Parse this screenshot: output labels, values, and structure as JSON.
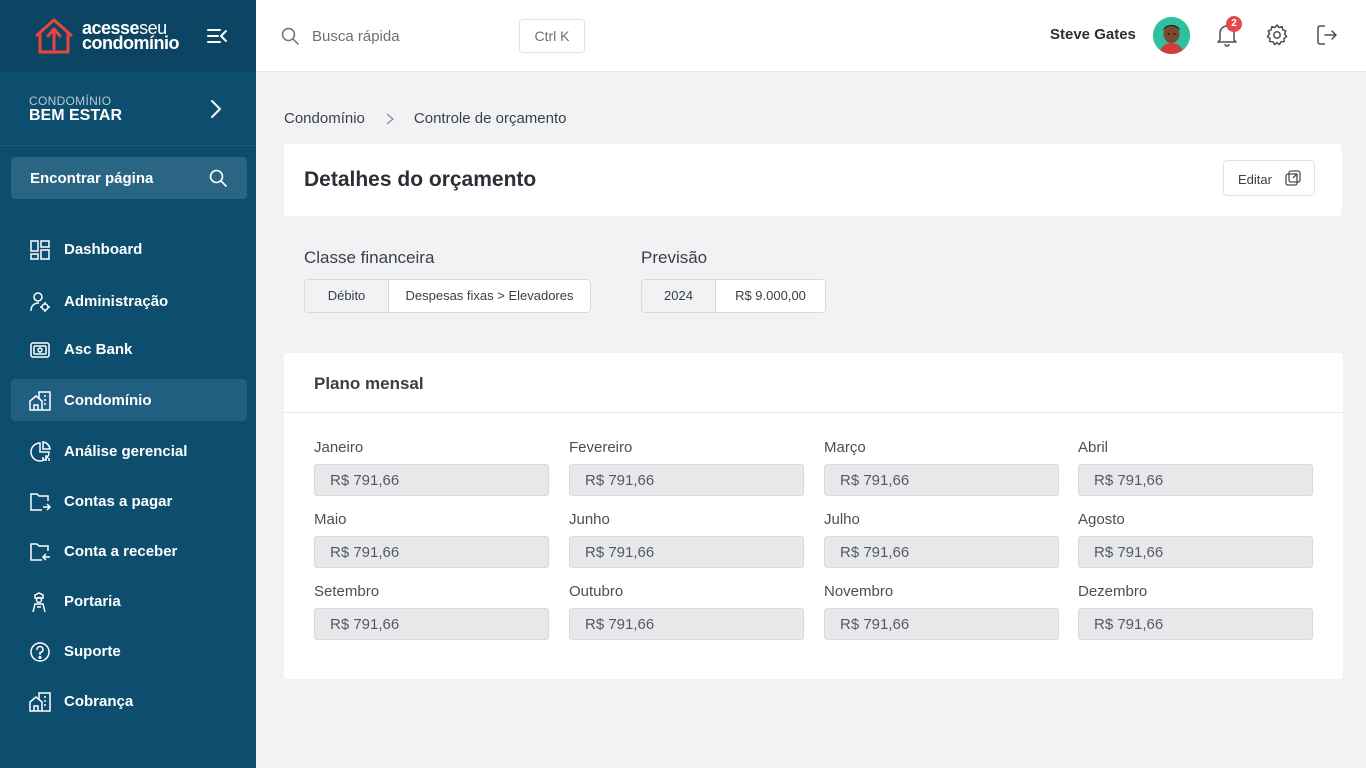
{
  "brand": {
    "line1_bold": "acesse",
    "line1_thin": "seu",
    "line2": "condomínio",
    "color": "#e8463d"
  },
  "sidebar": {
    "condo_caption": "CONDOMÍNIO",
    "condo_name": "BEM ESTAR",
    "find_label": "Encontrar página",
    "items": [
      {
        "label": "Dashboard",
        "icon": "dashboard-icon"
      },
      {
        "label": "Administração",
        "icon": "user-gear-icon"
      },
      {
        "label": "Asc Bank",
        "icon": "bank-icon"
      },
      {
        "label": "Condomínio",
        "icon": "building-icon",
        "active": true
      },
      {
        "label": "Análise gerencial",
        "icon": "analytics-icon"
      },
      {
        "label": "Contas a pagar",
        "icon": "folder-out-icon"
      },
      {
        "label": "Conta a receber",
        "icon": "folder-in-icon"
      },
      {
        "label": "Portaria",
        "icon": "doorman-icon"
      },
      {
        "label": "Suporte",
        "icon": "help-icon"
      },
      {
        "label": "Cobrança",
        "icon": "building-icon"
      }
    ]
  },
  "topbar": {
    "search_placeholder": "Busca rápida",
    "shortcut": "Ctrl K",
    "username": "Steve Gates",
    "notifications": "2"
  },
  "breadcrumb": {
    "root": "Condomínio",
    "current": "Controle de orçamento"
  },
  "header": {
    "title": "Detalhes do orçamento",
    "edit_label": "Editar"
  },
  "info": {
    "class_label": "Classe financeira",
    "class_type": "Débito",
    "class_path": "Despesas fixas > Elevadores",
    "forecast_label": "Previsão",
    "forecast_year": "2024",
    "forecast_value": "R$ 9.000,00"
  },
  "plan": {
    "title": "Plano mensal",
    "months": [
      {
        "label": "Janeiro",
        "value": "R$ 791,66"
      },
      {
        "label": "Fevereiro",
        "value": "R$ 791,66"
      },
      {
        "label": "Março",
        "value": "R$ 791,66"
      },
      {
        "label": "Abril",
        "value": "R$ 791,66"
      },
      {
        "label": "Maio",
        "value": "R$ 791,66"
      },
      {
        "label": "Junho",
        "value": "R$ 791,66"
      },
      {
        "label": "Julho",
        "value": "R$ 791,66"
      },
      {
        "label": "Agosto",
        "value": "R$ 791,66"
      },
      {
        "label": "Setembro",
        "value": "R$ 791,66"
      },
      {
        "label": "Outubro",
        "value": "R$ 791,66"
      },
      {
        "label": "Novembro",
        "value": "R$ 791,66"
      },
      {
        "label": "Dezembro",
        "value": "R$ 791,66"
      }
    ]
  }
}
